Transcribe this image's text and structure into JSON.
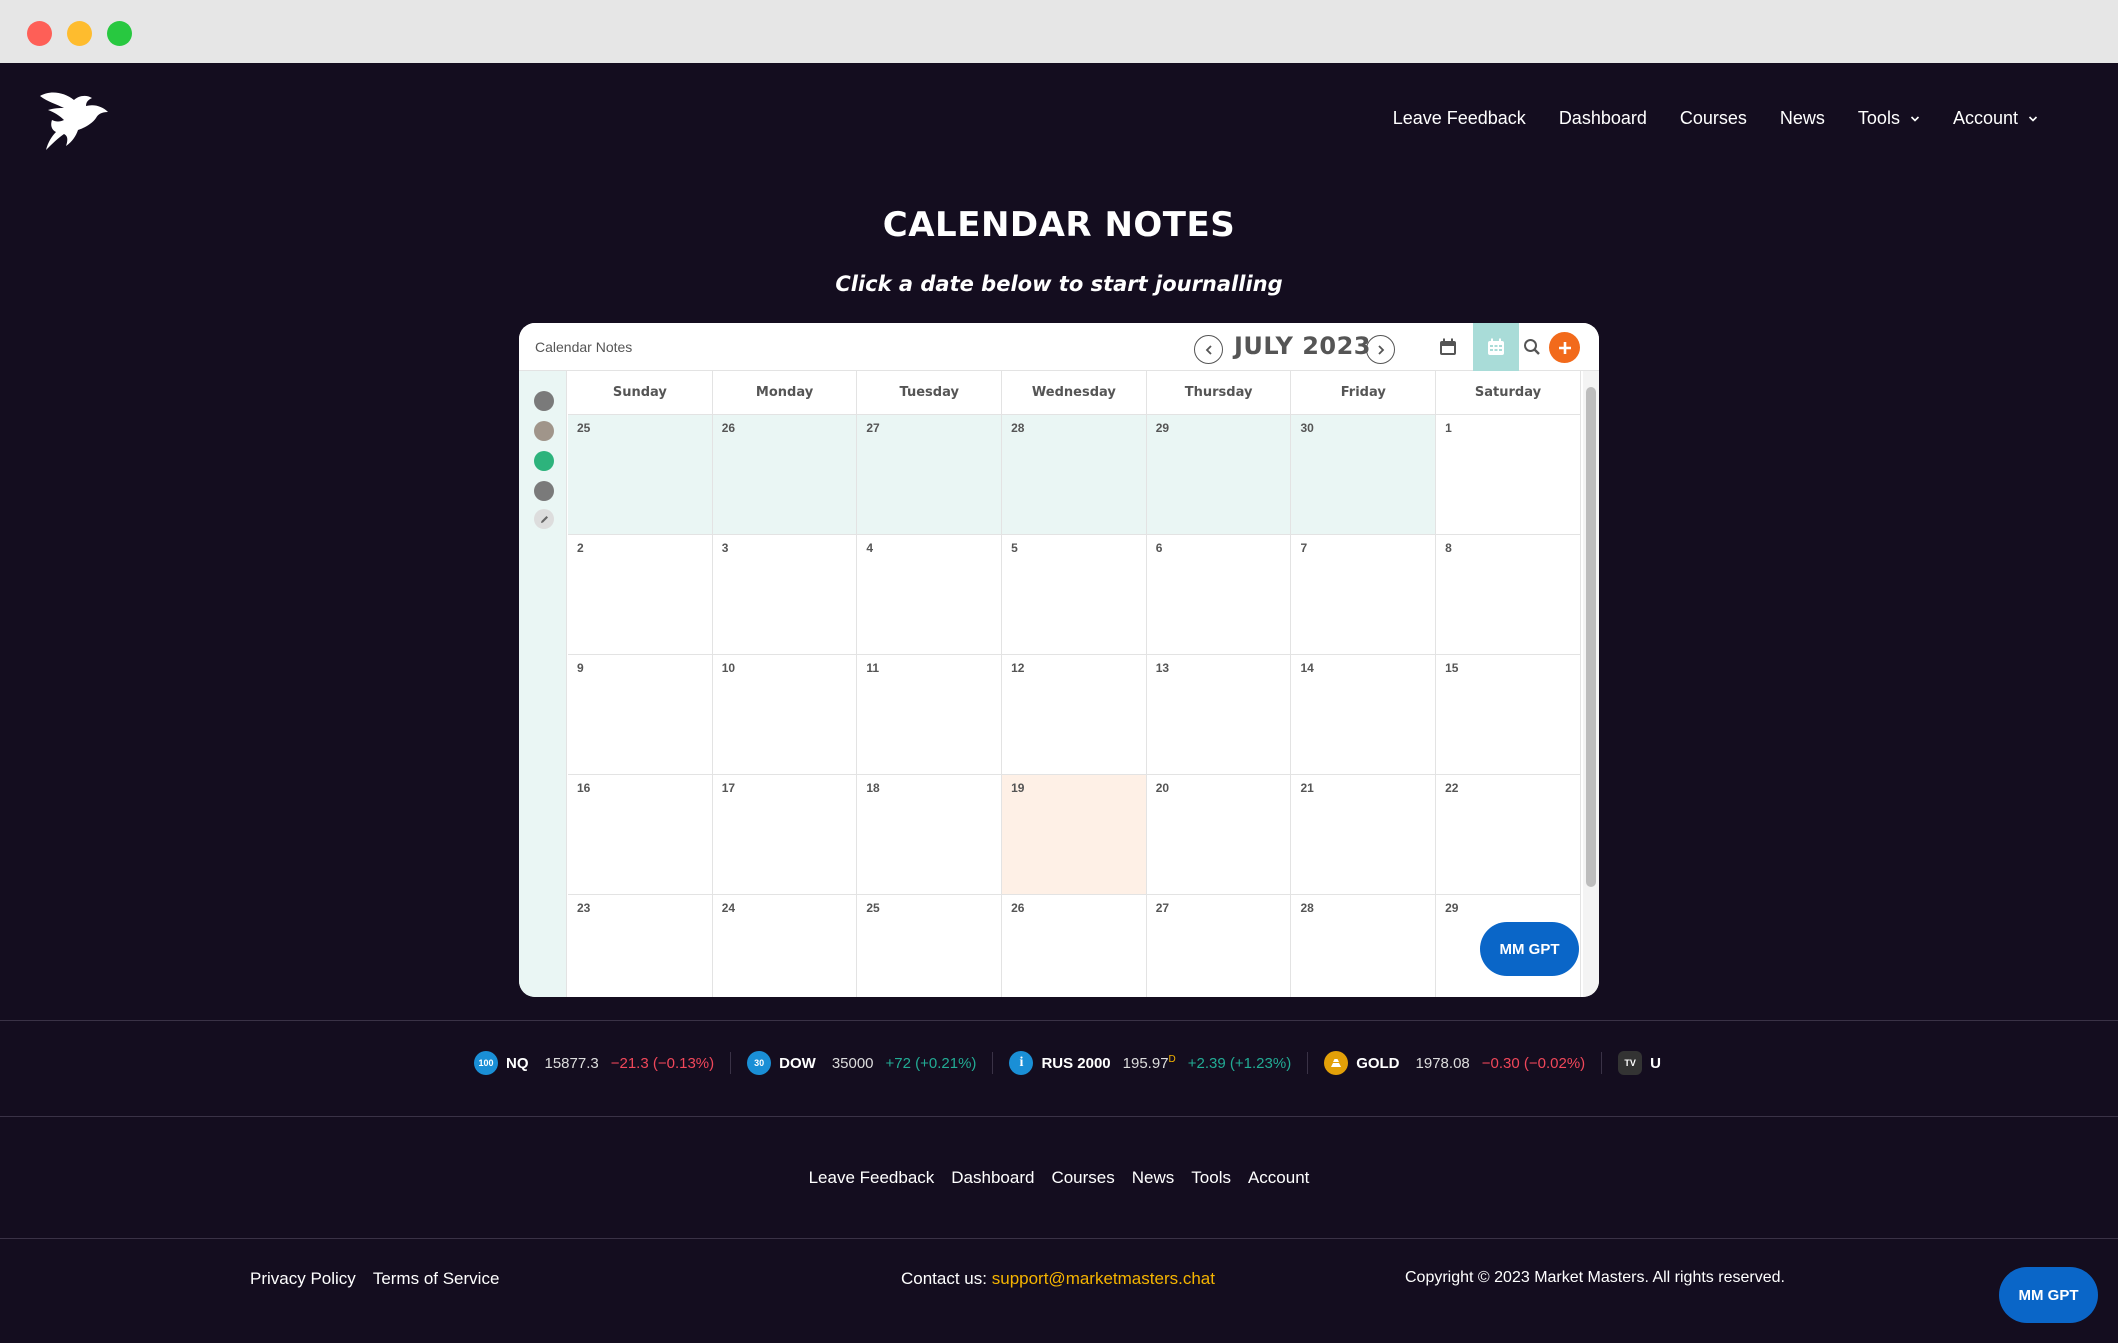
{
  "nav": {
    "items": [
      {
        "label": "Leave Feedback",
        "dropdown": false
      },
      {
        "label": "Dashboard",
        "dropdown": false
      },
      {
        "label": "Courses",
        "dropdown": false
      },
      {
        "label": "News",
        "dropdown": false
      },
      {
        "label": "Tools",
        "dropdown": true
      },
      {
        "label": "Account",
        "dropdown": true
      }
    ]
  },
  "page": {
    "title": "CALENDAR NOTES",
    "subtitle": "Click a date below to start journalling"
  },
  "calendar": {
    "name": "Calendar Notes",
    "month_label": "JULY 2023",
    "weekdays": [
      "Sunday",
      "Monday",
      "Tuesday",
      "Wednesday",
      "Thursday",
      "Friday",
      "Saturday"
    ],
    "swatch_colors": [
      "#7a7a7a",
      "#a0958a",
      "#2db37c",
      "#7a7a7a"
    ],
    "weeks": [
      [
        {
          "d": "25",
          "other": true
        },
        {
          "d": "26",
          "other": true
        },
        {
          "d": "27",
          "other": true
        },
        {
          "d": "28",
          "other": true
        },
        {
          "d": "29",
          "other": true
        },
        {
          "d": "30",
          "other": true
        },
        {
          "d": "1"
        }
      ],
      [
        {
          "d": "2"
        },
        {
          "d": "3"
        },
        {
          "d": "4"
        },
        {
          "d": "5"
        },
        {
          "d": "6"
        },
        {
          "d": "7"
        },
        {
          "d": "8"
        }
      ],
      [
        {
          "d": "9"
        },
        {
          "d": "10"
        },
        {
          "d": "11"
        },
        {
          "d": "12"
        },
        {
          "d": "13"
        },
        {
          "d": "14"
        },
        {
          "d": "15"
        }
      ],
      [
        {
          "d": "16"
        },
        {
          "d": "17"
        },
        {
          "d": "18"
        },
        {
          "d": "19",
          "today": true
        },
        {
          "d": "20"
        },
        {
          "d": "21"
        },
        {
          "d": "22"
        }
      ],
      [
        {
          "d": "23"
        },
        {
          "d": "24"
        },
        {
          "d": "25"
        },
        {
          "d": "26"
        },
        {
          "d": "27"
        },
        {
          "d": "28"
        },
        {
          "d": "29"
        }
      ]
    ],
    "accent_color": "#f26a1b",
    "today_color": "#fef0e6",
    "other_month_color": "#eaf6f4"
  },
  "assistant": {
    "label": "MM GPT"
  },
  "ticker": [
    {
      "badge": "100",
      "badge_color": "#1a8fd6",
      "symbol": "NQ",
      "value": "15877.3",
      "change": "−21.3 (−0.13%)",
      "dir": "neg"
    },
    {
      "badge": "30",
      "badge_color": "#1a8fd6",
      "symbol": "DOW",
      "value": "35000",
      "change": "+72 (+0.21%)",
      "dir": "pos"
    },
    {
      "badge": "i",
      "badge_color": "#1a8fd6",
      "symbol": "RUS 2000",
      "value": "195.97",
      "value_sup": "D",
      "change": "+2.39 (+1.23%)",
      "dir": "pos"
    },
    {
      "badge": "",
      "badge_color": "#e3a008",
      "symbol": "GOLD",
      "value": "1978.08",
      "change": "−0.30 (−0.02%)",
      "dir": "neg"
    }
  ],
  "ticker_tail": "U",
  "footer": {
    "nav": [
      "Leave Feedback",
      "Dashboard",
      "Courses",
      "News",
      "Tools",
      "Account"
    ],
    "privacy": "Privacy Policy",
    "terms": "Terms of Service",
    "contact_label": "Contact us:",
    "contact_email": "support@marketmasters.chat",
    "copyright": "Copyright © 2023 Market Masters. All rights reserved."
  }
}
